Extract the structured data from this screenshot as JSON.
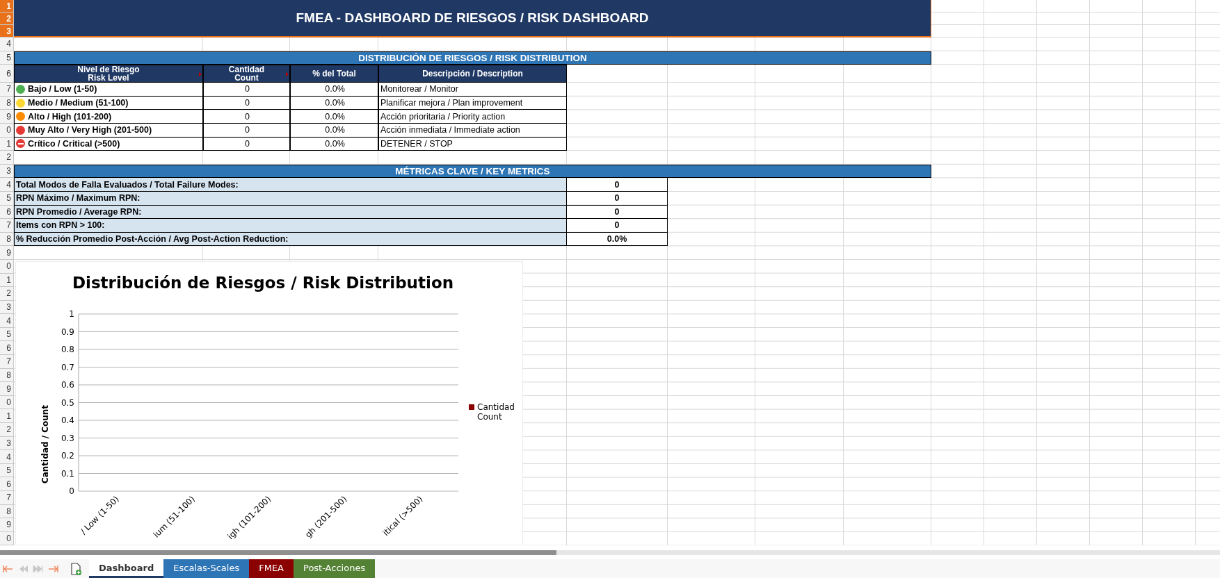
{
  "title": "FMEA - DASHBOARD DE RIESGOS / RISK DASHBOARD",
  "row_headers": [
    {
      "label": "1",
      "selected": true
    },
    {
      "label": "2",
      "selected": true
    },
    {
      "label": "3",
      "selected": true
    },
    {
      "label": "4",
      "selected": false
    },
    {
      "label": "5",
      "selected": false
    },
    {
      "label": "6",
      "selected": false
    },
    {
      "label": "7",
      "selected": false
    },
    {
      "label": "8",
      "selected": false
    },
    {
      "label": "9",
      "selected": false
    },
    {
      "label": "0",
      "selected": false
    },
    {
      "label": "1",
      "selected": false
    },
    {
      "label": "2",
      "selected": false
    },
    {
      "label": "3",
      "selected": false
    },
    {
      "label": "4",
      "selected": false
    },
    {
      "label": "5",
      "selected": false
    },
    {
      "label": "6",
      "selected": false
    },
    {
      "label": "7",
      "selected": false
    },
    {
      "label": "8",
      "selected": false
    },
    {
      "label": "9",
      "selected": false
    },
    {
      "label": "0",
      "selected": false
    },
    {
      "label": "1",
      "selected": false
    },
    {
      "label": "2",
      "selected": false
    },
    {
      "label": "3",
      "selected": false
    },
    {
      "label": "4",
      "selected": false
    },
    {
      "label": "5",
      "selected": false
    },
    {
      "label": "6",
      "selected": false
    },
    {
      "label": "7",
      "selected": false
    },
    {
      "label": "8",
      "selected": false
    },
    {
      "label": "9",
      "selected": false
    },
    {
      "label": "0",
      "selected": false
    },
    {
      "label": "1",
      "selected": false
    },
    {
      "label": "2",
      "selected": false
    },
    {
      "label": "3",
      "selected": false
    },
    {
      "label": "4",
      "selected": false
    },
    {
      "label": "5",
      "selected": false
    },
    {
      "label": "6",
      "selected": false
    },
    {
      "label": "7",
      "selected": false
    },
    {
      "label": "8",
      "selected": false
    },
    {
      "label": "9",
      "selected": false
    },
    {
      "label": "0",
      "selected": false
    }
  ],
  "distribution": {
    "heading": "DISTRIBUCIÓN DE RIESGOS / RISK DISTRIBUTION",
    "columns": [
      {
        "lines": [
          "Nivel de Riesgo",
          "Risk Level"
        ],
        "marker": true
      },
      {
        "lines": [
          "Cantidad",
          "Count"
        ],
        "marker": true
      },
      {
        "lines": [
          "% del Total"
        ],
        "marker": false
      },
      {
        "lines": [
          "Descripción / Description"
        ],
        "marker": false
      }
    ],
    "rows": [
      {
        "kind": "dot",
        "color": "#4caf50",
        "level": "Bajo / Low (1-50)",
        "count": "0",
        "percent": "0.0%",
        "description": "Monitorear / Monitor"
      },
      {
        "kind": "dot",
        "color": "#fdd835",
        "level": "Medio / Medium (51-100)",
        "count": "0",
        "percent": "0.0%",
        "description": "Planificar mejora / Plan improvement"
      },
      {
        "kind": "dot",
        "color": "#fb8c00",
        "level": "Alto / High (101-200)",
        "count": "0",
        "percent": "0.0%",
        "description": "Acción prioritaria / Priority action"
      },
      {
        "kind": "dot",
        "color": "#e53935",
        "level": "Muy Alto / Very High (201-500)",
        "count": "0",
        "percent": "0.0%",
        "description": "Acción inmediata / Immediate action"
      },
      {
        "kind": "no-entry",
        "color": "#e53935",
        "level": "Crítico / Critical (>500)",
        "count": "0",
        "percent": "0.0%",
        "description": "DETENER / STOP"
      }
    ]
  },
  "metrics": {
    "heading": "MÉTRICAS CLAVE / KEY METRICS",
    "rows": [
      {
        "label": "Total Modos de Falla Evaluados / Total Failure Modes:",
        "value": "0"
      },
      {
        "label": "RPN Máximo / Maximum RPN:",
        "value": "0"
      },
      {
        "label": "RPN Promedio / Average RPN:",
        "value": "0"
      },
      {
        "label": "Items con RPN > 100:",
        "value": "0"
      },
      {
        "label": "% Reducción Promedio Post-Acción / Avg Post-Action Reduction:",
        "value": "0.0%"
      }
    ]
  },
  "chart": {
    "chart_data": {
      "type": "bar",
      "title": "Distribución de Riesgos / Risk Distribution",
      "ylabel": "Cantidad / Count",
      "categories": [
        "/ Low (1-50)",
        "ium (51-100)",
        "igh (101-200)",
        "gh (201-500)",
        "itical (>500)"
      ],
      "series": [
        {
          "name": "Cantidad Count",
          "color": "#8b0000",
          "values": [
            0,
            0,
            0,
            0,
            0
          ]
        }
      ],
      "ylim": [
        0,
        1
      ],
      "grid": true,
      "yticks": [
        0,
        0.1,
        0.2,
        0.3,
        0.4,
        0.5,
        0.6,
        0.7,
        0.8,
        0.9,
        1
      ]
    }
  },
  "sheet_tabs": [
    {
      "label": "Dashboard",
      "color": "#ffffff",
      "selected": true
    },
    {
      "label": "Escalas-Scales",
      "color": "#2e75b6",
      "selected": false
    },
    {
      "label": "FMEA",
      "color": "#8b0000",
      "selected": false
    },
    {
      "label": "Post-Acciones",
      "color": "#548235",
      "selected": false
    }
  ]
}
